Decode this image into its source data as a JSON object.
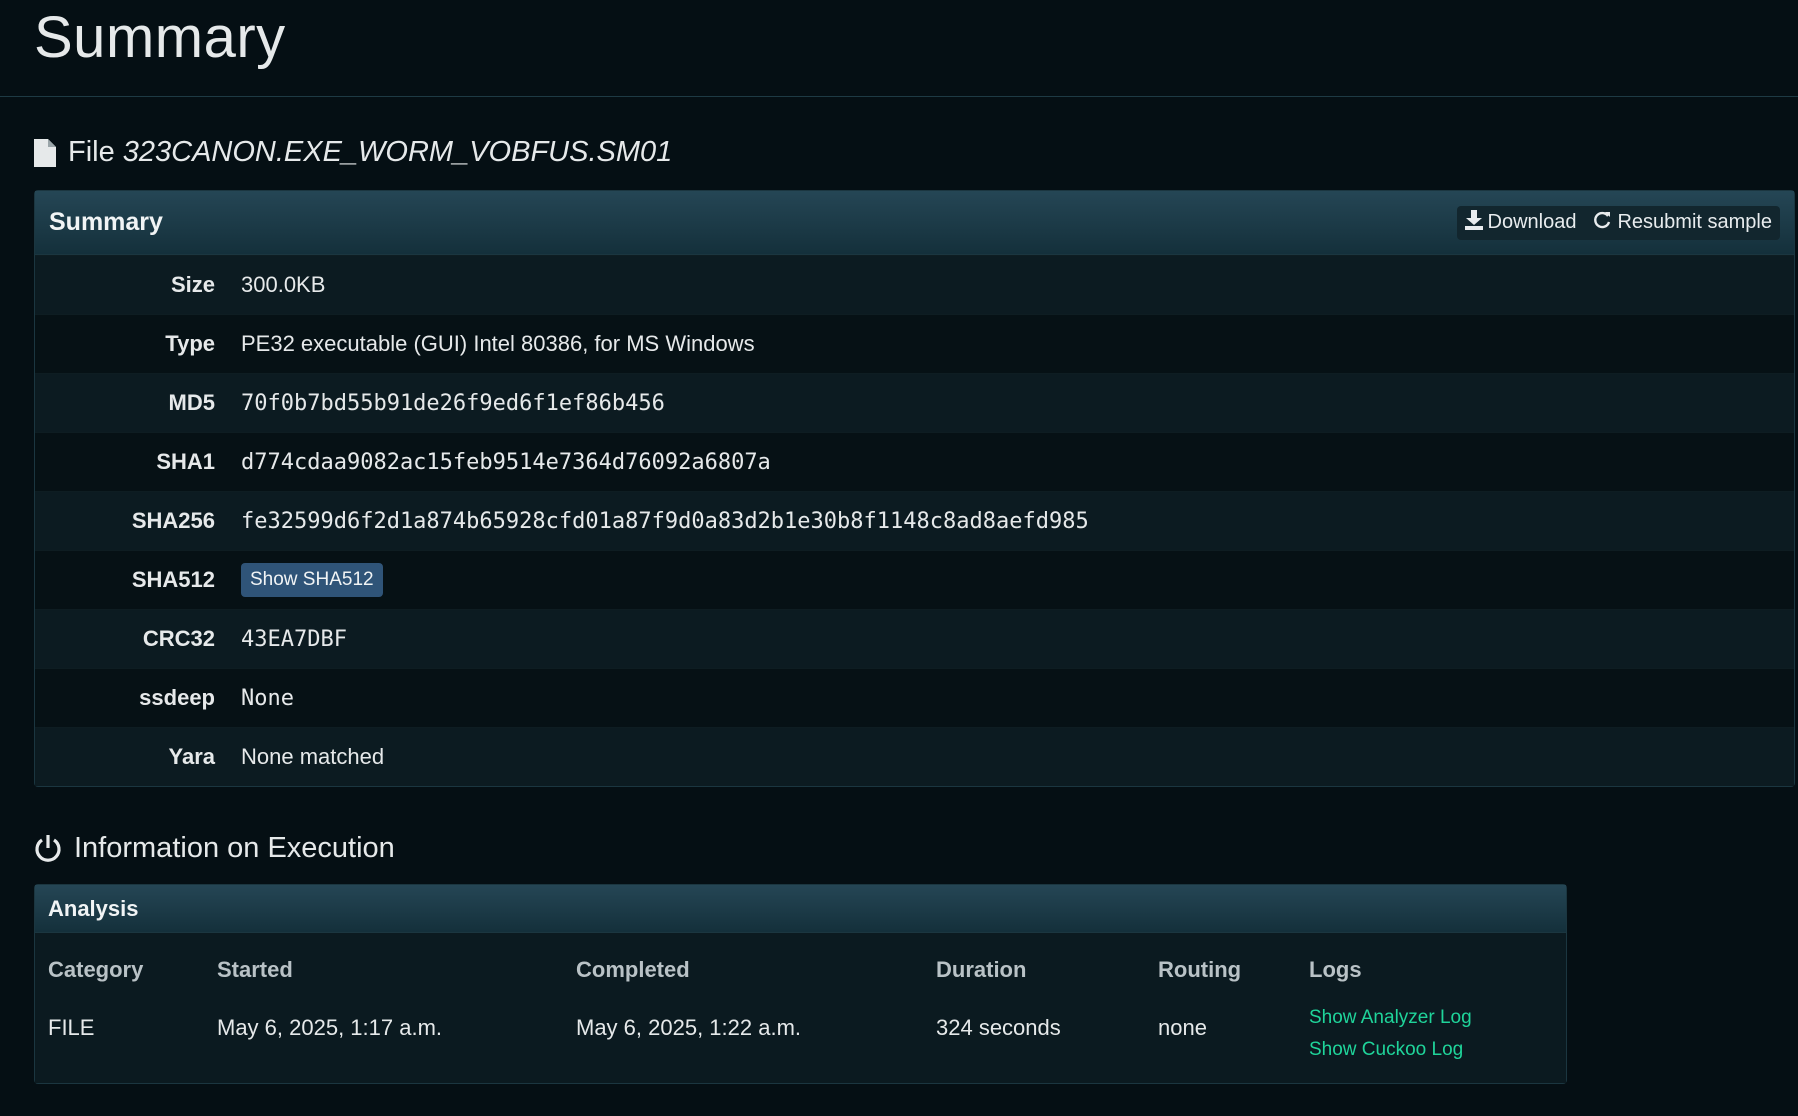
{
  "page": {
    "title": "Summary"
  },
  "file_section": {
    "prefix": "File",
    "filename": "323CANON.EXE_WORM_VOBFUS.SM01"
  },
  "summary_panel": {
    "title": "Summary",
    "download_label": "Download",
    "resubmit_label": "Resubmit sample",
    "rows": [
      {
        "key": "Size",
        "value": "300.0KB"
      },
      {
        "key": "Type",
        "value": "PE32 executable (GUI) Intel 80386, for MS Windows"
      },
      {
        "key": "MD5",
        "value": "70f0b7bd55b91de26f9ed6f1ef86b456"
      },
      {
        "key": "SHA1",
        "value": "d774cdaa9082ac15feb9514e7364d76092a6807a"
      },
      {
        "key": "SHA256",
        "value": "fe32599d6f2d1a874b65928cfd01a87f9d0a83d2b1e30b8f1148c8ad8aefd985"
      },
      {
        "key": "SHA512",
        "button": "Show SHA512"
      },
      {
        "key": "CRC32",
        "value": "43EA7DBF"
      },
      {
        "key": "ssdeep",
        "value": "None"
      },
      {
        "key": "Yara",
        "value": "None matched"
      }
    ]
  },
  "execution_section": {
    "title": "Information on Execution"
  },
  "analysis_panel": {
    "title": "Analysis",
    "columns": [
      "Category",
      "Started",
      "Completed",
      "Duration",
      "Routing",
      "Logs"
    ],
    "row": {
      "category": "FILE",
      "started": "May 6, 2025, 1:17 a.m.",
      "completed": "May 6, 2025, 1:22 a.m.",
      "duration": "324 seconds",
      "routing": "none",
      "logs": [
        "Show Analyzer Log",
        "Show Cuckoo Log"
      ]
    }
  },
  "colors": {
    "background": "#050f14",
    "panel_header": "#254655",
    "link": "#1fd49a",
    "button": "#2f5478"
  }
}
